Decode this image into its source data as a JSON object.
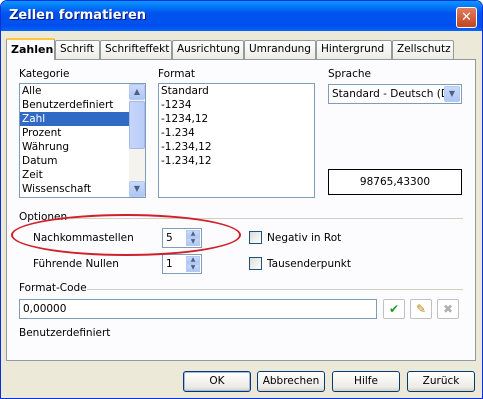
{
  "window": {
    "title": "Zellen formatieren"
  },
  "tabs": [
    "Zahlen",
    "Schrift",
    "Schrifteffekt",
    "Ausrichtung",
    "Umrandung",
    "Hintergrund",
    "Zellschutz"
  ],
  "kategorie": {
    "label": "Kategorie",
    "items": [
      "Alle",
      "Benutzerdefiniert",
      "Zahl",
      "Prozent",
      "Währung",
      "Datum",
      "Zeit",
      "Wissenschaft"
    ],
    "selected": "Zahl"
  },
  "format": {
    "label": "Format",
    "items": [
      "Standard",
      "-1234",
      "-1234,12",
      "-1.234",
      "-1.234,12",
      "-1.234,12"
    ]
  },
  "sprache": {
    "label": "Sprache",
    "value": "Standard - Deutsch (De"
  },
  "preview": "98765,43300",
  "optionen": {
    "label": "Optionen",
    "nachkommastellen_label": "Nachkommastellen",
    "nachkommastellen_value": "5",
    "fuehrende_nullen_label": "Führende Nullen",
    "fuehrende_nullen_value": "1",
    "negativ_label": "Negativ in Rot",
    "tausender_label": "Tausenderpunkt"
  },
  "format_code": {
    "label": "Format-Code",
    "value": "0,00000",
    "description": "Benutzerdefiniert"
  },
  "buttons": {
    "ok": "OK",
    "cancel": "Abbrechen",
    "help": "Hilfe",
    "back": "Zurück"
  },
  "colors": {
    "title_blue": "#0054E3",
    "selection": "#316AC5",
    "highlight_ellipse": "#D0202A",
    "tab_accent": "#FFC83C"
  }
}
